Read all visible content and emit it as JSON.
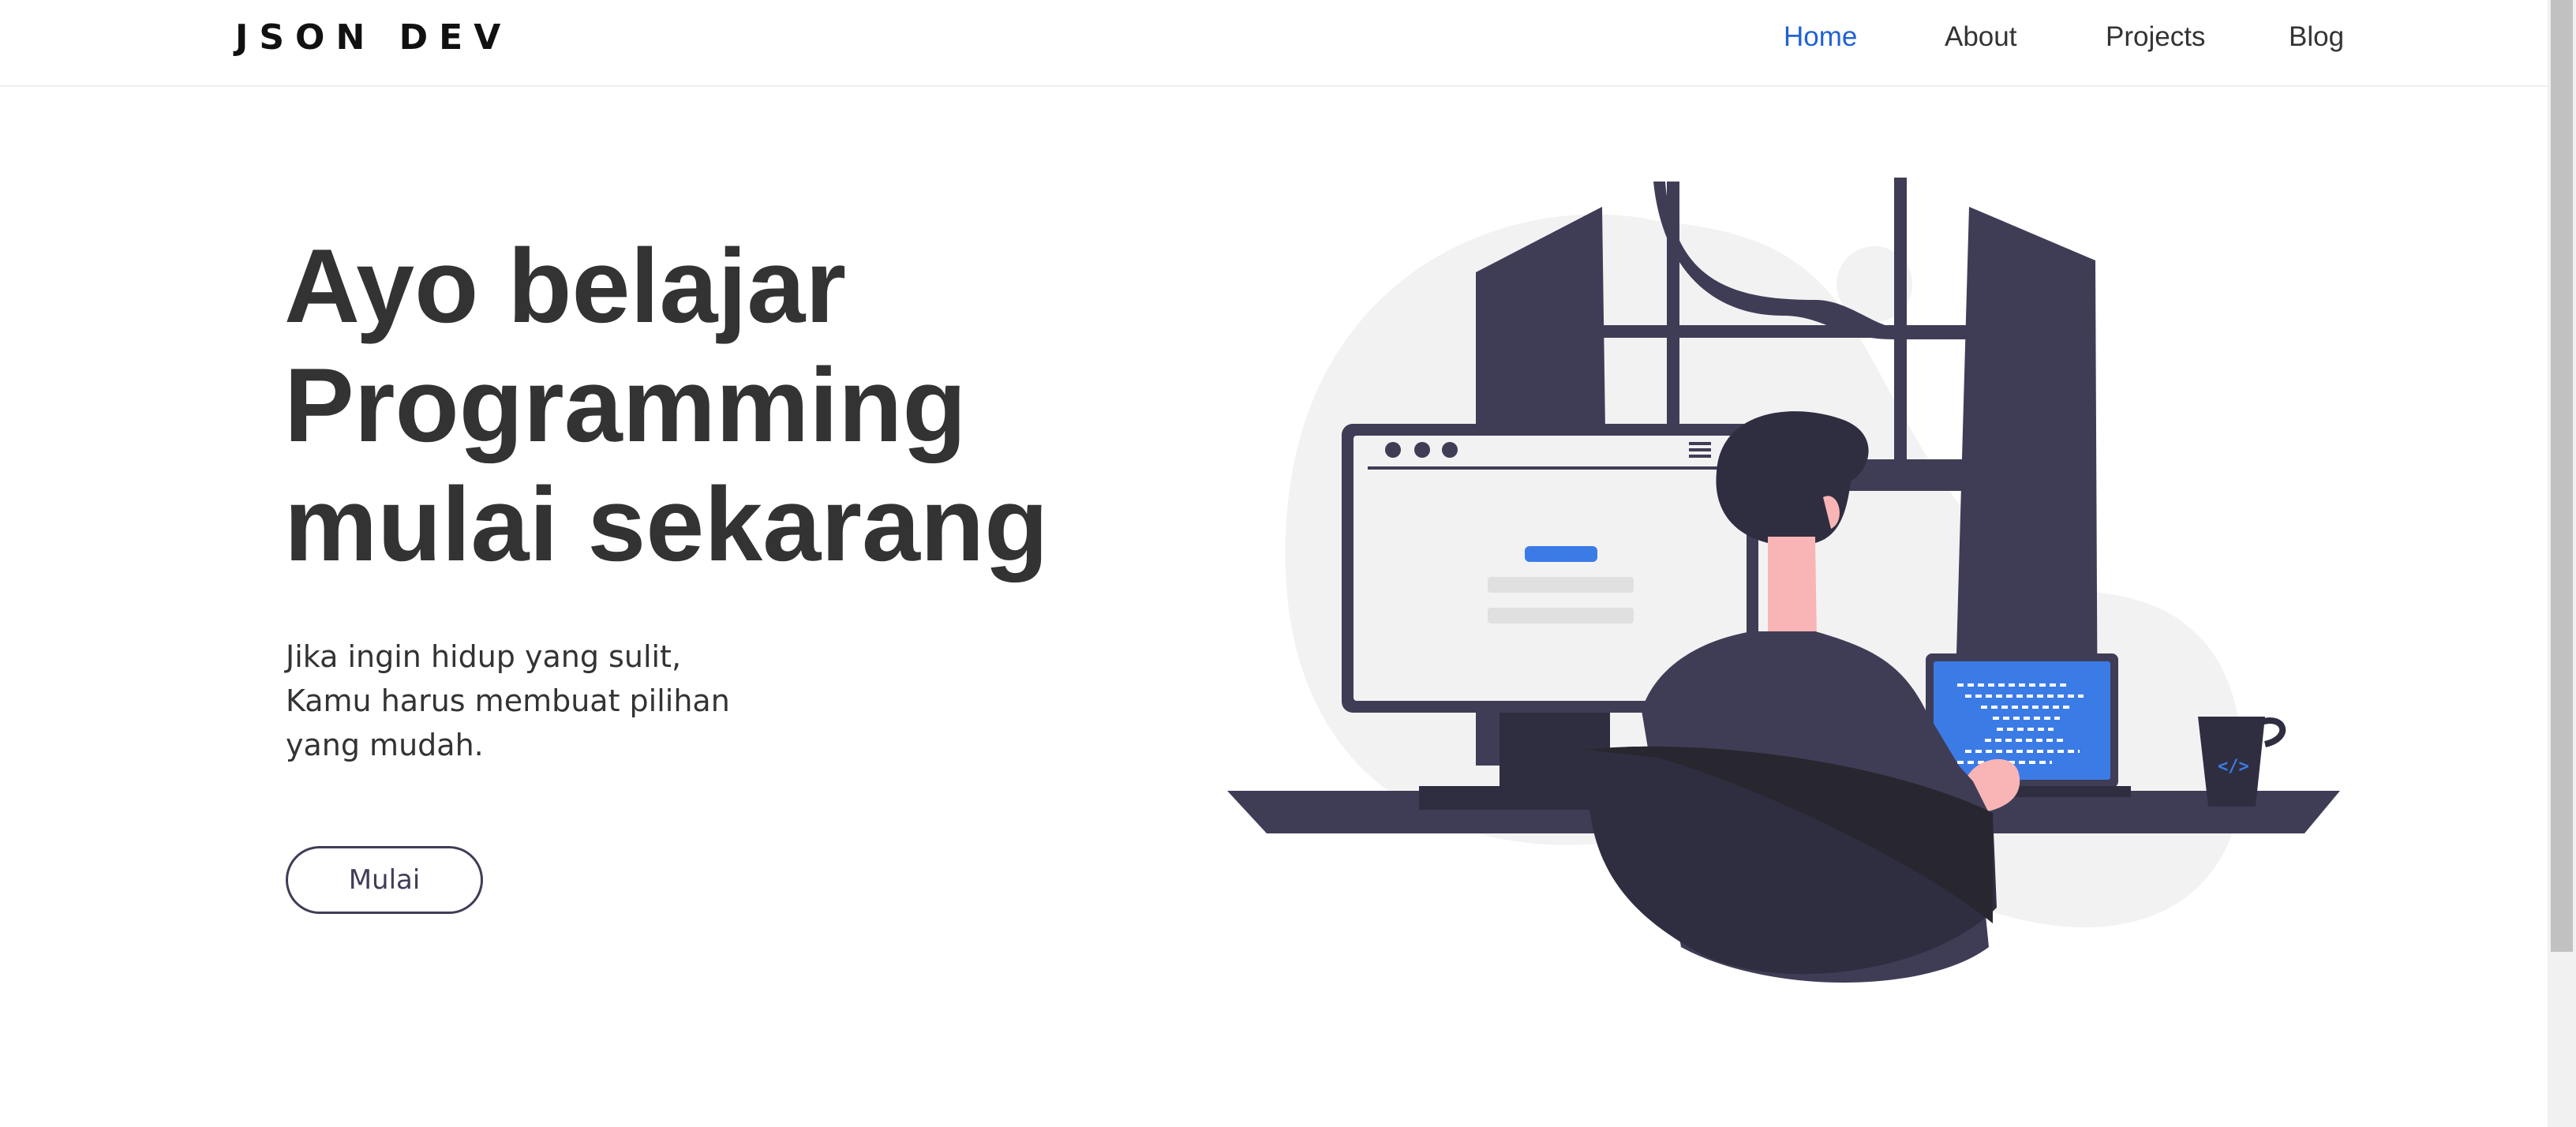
{
  "navbar": {
    "brand": "JSON DEV",
    "links": [
      {
        "label": "Home",
        "active": true
      },
      {
        "label": "About",
        "active": false
      },
      {
        "label": "Projects",
        "active": false
      },
      {
        "label": "Blog",
        "active": false
      }
    ]
  },
  "hero": {
    "title_lines": [
      "Ayo belajar",
      "Programming",
      "mulai sekarang"
    ],
    "subtitle_lines": [
      "Jika ingin hidup yang sulit,",
      "Kamu harus membuat pilihan",
      "yang mudah."
    ],
    "cta_label": "Mulai"
  },
  "illustration": {
    "monitor_code_glyph": "</>"
  },
  "colors": {
    "accent": "#1f62d4",
    "text": "#333333",
    "dark_figure": "#3f3d56",
    "blob": "#f2f2f2",
    "laptop_screen": "#3b7be6",
    "skin": "#f9b5b5"
  }
}
